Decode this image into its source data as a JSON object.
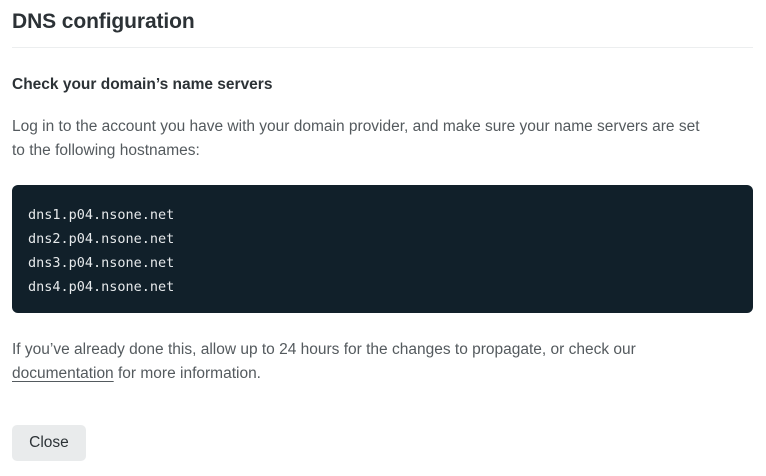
{
  "dialog": {
    "title": "DNS configuration",
    "subtitle": "Check your domain’s name servers",
    "intro": "Log in to the account you have with your domain provider, and make sure your name servers are set to the following hostnames:",
    "hostnames": [
      "dns1.p04.nsone.net",
      "dns2.p04.nsone.net",
      "dns3.p04.nsone.net",
      "dns4.p04.nsone.net"
    ],
    "footer": {
      "before_link": "If you’ve already done this, allow up to 24 hours for the changes to propagate, or check our ",
      "link_text": "documentation",
      "after_link": " for more information."
    },
    "close_label": "Close"
  }
}
